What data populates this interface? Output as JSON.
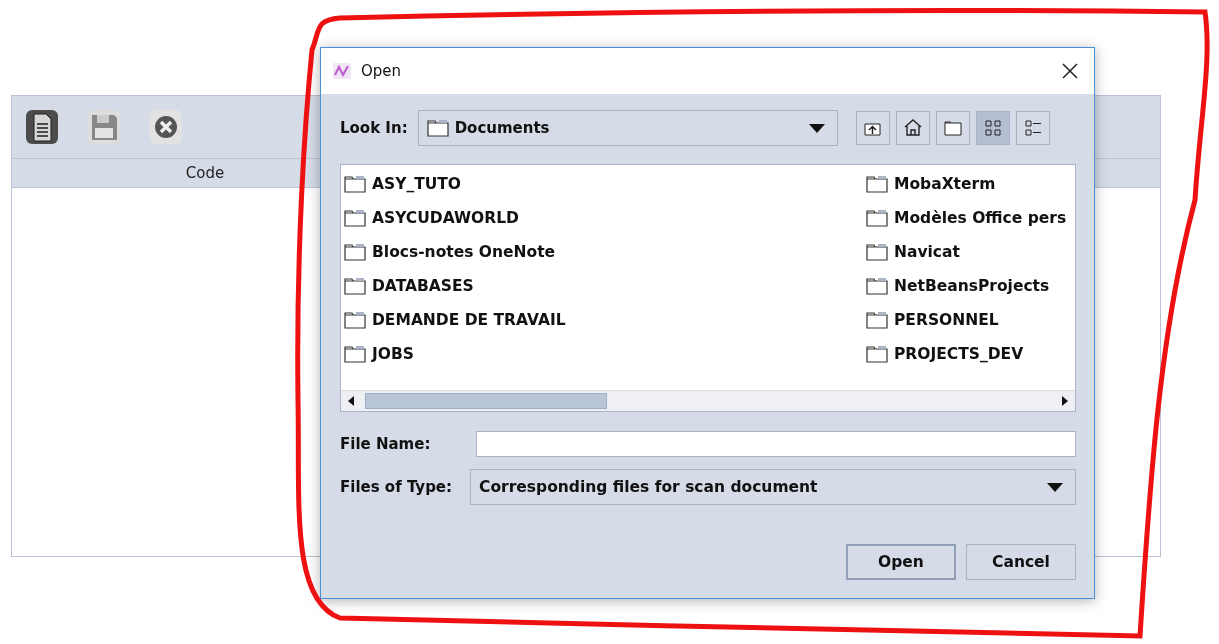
{
  "main_window": {
    "toolbar": [
      {
        "kind": "document",
        "selected": true
      },
      {
        "kind": "save",
        "selected": false
      },
      {
        "kind": "close",
        "selected": false
      }
    ],
    "table": {
      "columns": [
        "Code"
      ]
    }
  },
  "dialog": {
    "title": "Open",
    "look_in": {
      "label": "Look In:",
      "value": "Documents"
    },
    "view_buttons": [
      {
        "kind": "up",
        "selected": false
      },
      {
        "kind": "home",
        "selected": false
      },
      {
        "kind": "new-folder",
        "selected": false
      },
      {
        "kind": "list",
        "selected": true
      },
      {
        "kind": "details",
        "selected": false
      }
    ],
    "files": [
      {
        "name": "ASY_TUTO"
      },
      {
        "name": "ASYCUDAWORLD"
      },
      {
        "name": "Blocs-notes OneNote"
      },
      {
        "name": "DATABASES"
      },
      {
        "name": "DEMANDE DE TRAVAIL"
      },
      {
        "name": "JOBS"
      },
      {
        "name": "MobaXterm"
      },
      {
        "name": "Modèles Office pers"
      },
      {
        "name": "Navicat"
      },
      {
        "name": "NetBeansProjects"
      },
      {
        "name": "PERSONNEL"
      },
      {
        "name": "PROJECTS_DEV"
      }
    ],
    "file_name": {
      "label": "File Name:"
    },
    "files_of_type": {
      "label": "Files of Type:",
      "value": "Corresponding files for scan document"
    },
    "buttons": [
      {
        "label": "Open",
        "selected": true
      },
      {
        "label": "Cancel",
        "selected": false
      }
    ]
  }
}
